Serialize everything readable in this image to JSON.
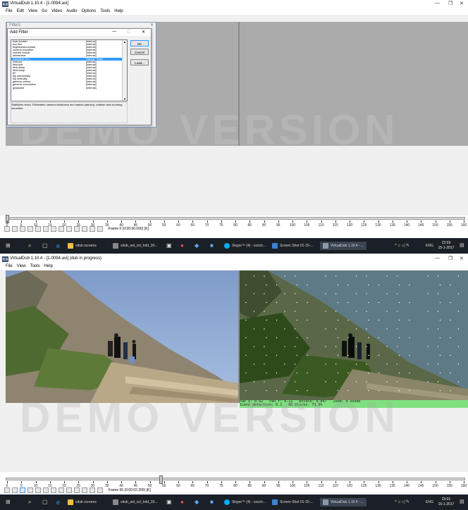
{
  "top": {
    "title": "VirtualDub 1.10.4 - [1-0094.avi]",
    "menu": [
      "File",
      "Edit",
      "View",
      "Go",
      "Video",
      "Audio",
      "Options",
      "Tools",
      "Help"
    ],
    "filters_window_title": "Filters",
    "watermark": "DEMO VERSION",
    "add_filter": {
      "title": "Add Filter",
      "items": [
        {
          "name": "blob doubler",
          "src": "[internal]"
        },
        {
          "name": "box blur",
          "src": "[internal]"
        },
        {
          "name": "brightness/contrast",
          "src": "[internal]"
        },
        {
          "name": "chroma smoother",
          "src": "[internal]"
        },
        {
          "name": "convert format",
          "src": "[internal]"
        },
        {
          "name": "deinterlace",
          "src": "[internal]"
        },
        {
          "name": "Deshaker v3.1",
          "src": "Gunnar Thalin"
        },
        {
          "name": "emboss",
          "src": "[internal]"
        },
        {
          "name": "field bob",
          "src": "[internal]"
        },
        {
          "name": "field delay",
          "src": "[internal]"
        },
        {
          "name": "field swap",
          "src": "[internal]"
        },
        {
          "name": "fill",
          "src": "[internal]"
        },
        {
          "name": "flip horizontally",
          "src": "[internal]"
        },
        {
          "name": "flip vertically",
          "src": "[internal]"
        },
        {
          "name": "gamma correct",
          "src": "[internal]"
        },
        {
          "name": "general convolution",
          "src": "[internal]"
        },
        {
          "name": "grayscale",
          "src": "[internal]"
        }
      ],
      "selected_index": 6,
      "buttons": [
        "OK",
        "Cancel",
        "Load..."
      ],
      "description": "Stabilizes video. Eliminates camera shakiness and makes panning, rotation and zooming smoother."
    },
    "frame_label": "Frame 0 (0:00:00.000) [K]",
    "timeline_position": 0.0,
    "taskbar": {
      "items": [
        "vdub screens",
        "vdub_wd_xxl_hdd_30...",
        "Skype™ (4) - cezch...",
        "Screen Shot 01-15-...",
        "VirtualDub 1.10.4 - ..."
      ],
      "lang": "ENG",
      "time": "22:59",
      "date": "15-1-2017"
    }
  },
  "bottom": {
    "title": "VirtualDub 1.10.4 - [1-0094.avi] (dub in progress)",
    "menu": [
      "File",
      "View",
      "Tools",
      "Help"
    ],
    "watermark": "DEMO VERSION",
    "status_line1": "Pan X: 0.02   Pan Y: 0.11   Rotate: 0.047   Zoom: 0.99986",
    "status_line2": "Scene detection: 0.1   OK blocks: 73.9%",
    "frame_label": "Frame 55 (0:00:02.200) [K]",
    "timeline_position": 0.336,
    "taskbar": {
      "items": [
        "vdub screens",
        "vdub_wd_xxl_hdd_30...",
        "Skype™ (4) - cezch...",
        "Screen Shot 01-15-...",
        "VirtualDub 1.10.4 - ..."
      ],
      "lang": "ENG",
      "time": "23:01",
      "date": "15-1-2017"
    }
  },
  "ticks": [
    "0",
    "5",
    "10",
    "15",
    "20",
    "25",
    "30",
    "35",
    "40",
    "45",
    "50",
    "55",
    "60",
    "65",
    "70",
    "75",
    "80",
    "85",
    "90",
    "95",
    "100",
    "105",
    "110",
    "115",
    "120",
    "125",
    "130",
    "135",
    "140",
    "145",
    "150",
    "155",
    "160"
  ],
  "colors": {
    "pane": "#ababab",
    "taskbar": "#1b2026",
    "selection": "#3399ff",
    "status": "#7fe07f"
  }
}
